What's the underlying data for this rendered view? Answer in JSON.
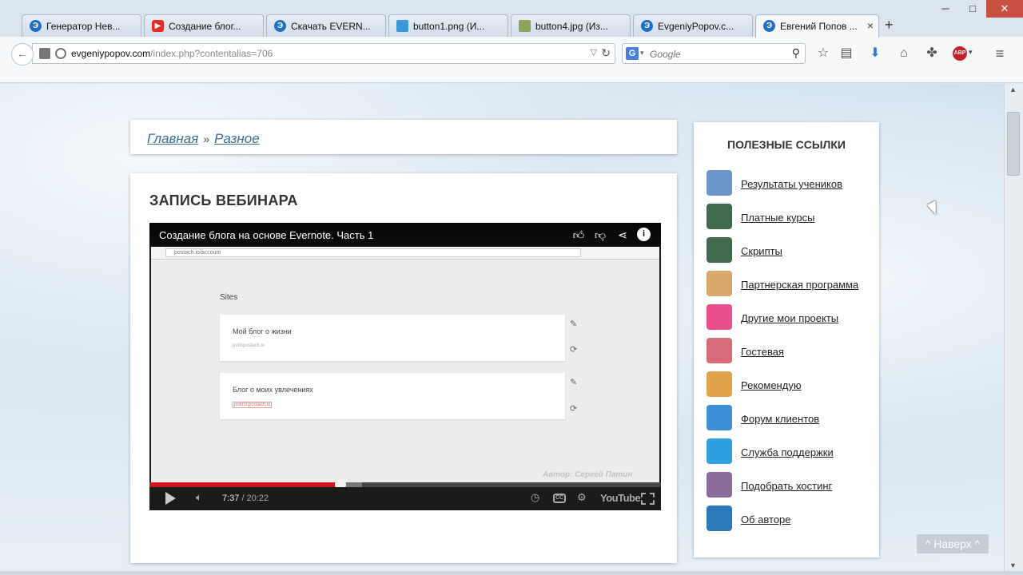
{
  "browser": {
    "tabs": [
      {
        "title": "Генератор Нев...",
        "favicon": "evgeniy-icon"
      },
      {
        "title": "Создание блог...",
        "favicon": "youtube-icon"
      },
      {
        "title": "Скачать EVERN...",
        "favicon": "evgeniy-icon"
      },
      {
        "title": "button1.png (И...",
        "favicon": "image-icon"
      },
      {
        "title": "button4.jpg (Из...",
        "favicon": "jpg-icon"
      },
      {
        "title": "EvgeniyPopov.c...",
        "favicon": "evgeniy-icon"
      },
      {
        "title": "Евгений Попов ...",
        "favicon": "evgeniy-icon",
        "active": true
      }
    ],
    "url_host": "evgeniypopov.com",
    "url_path": "/index.php?contentalias=706",
    "search_placeholder": "Google",
    "search_engine": "G",
    "abp_label": "ABP",
    "new_tab": "+",
    "window_minimize": "─",
    "window_maximize": "□",
    "window_close": "✕"
  },
  "breadcrumbs": {
    "home": "Главная",
    "separator": "»",
    "current": "Разное"
  },
  "content": {
    "title": "ЗАПИСЬ ВЕБИНАРА"
  },
  "video": {
    "title": "Создание блога на основе Evernote. Часть 1",
    "current_time": "7:37",
    "time_separator": " / ",
    "duration": "20:22",
    "played_fraction": 0.374,
    "buffered_fraction": 0.415,
    "cc_label": "CC",
    "youtube_label": "YouTube",
    "inner_url": "postach.io/account",
    "inner_sites_label": "Sites",
    "inner_blogs": [
      {
        "title": "Мой блог о жизни",
        "url": "putinpostach.io"
      },
      {
        "title": "Блог о моих увлечениях",
        "url": "putin3.postach.io"
      }
    ],
    "watermark": "Автор: Сергей Патин"
  },
  "sidebar": {
    "title": "ПОЛЕЗНЫЕ ССЫЛКИ",
    "items": [
      {
        "label": "Результаты учеников",
        "icon": "students-results-icon",
        "color": "#6a93c9"
      },
      {
        "label": "Платные курсы",
        "icon": "paid-courses-icon",
        "color": "#3f6b4f"
      },
      {
        "label": "Скрипты",
        "icon": "scripts-icon",
        "color": "#3f6b4f"
      },
      {
        "label": "Партнерская программа",
        "icon": "handshake-icon",
        "color": "#d9a86c"
      },
      {
        "label": "Другие мои проекты",
        "icon": "folders-icon",
        "color": "#e94f8a"
      },
      {
        "label": "Гостевая",
        "icon": "guestbook-icon",
        "color": "#d86b7a"
      },
      {
        "label": "Рекомендую",
        "icon": "thumbs-up-icon",
        "color": "#e0a24a"
      },
      {
        "label": "Форум клиентов",
        "icon": "forum-icon",
        "color": "#3b8fd6"
      },
      {
        "label": "Служба поддержки",
        "icon": "help-icon",
        "color": "#2f9fe0"
      },
      {
        "label": "Подобрать хостинг",
        "icon": "ninja-icon",
        "color": "#8a6b9a"
      },
      {
        "label": "Об авторе",
        "icon": "author-icon",
        "color": "#2d78b8"
      }
    ]
  },
  "to_top": "^ Наверх ^"
}
